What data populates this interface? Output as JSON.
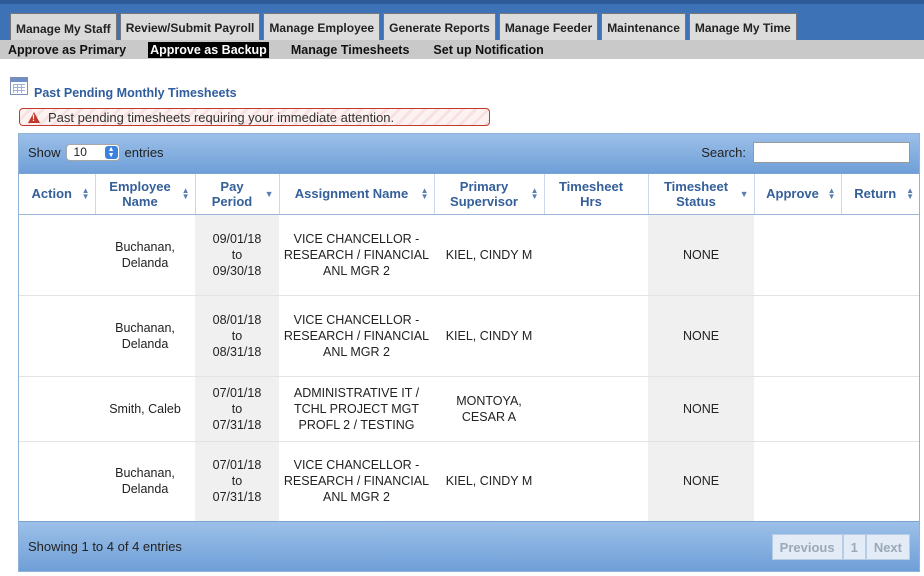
{
  "tabs": [
    {
      "label": "Manage My Staff"
    },
    {
      "label": "Review/Submit Payroll"
    },
    {
      "label": "Manage Employee"
    },
    {
      "label": "Generate Reports"
    },
    {
      "label": "Manage Feeder"
    },
    {
      "label": "Maintenance"
    },
    {
      "label": "Manage My Time"
    }
  ],
  "subnav": [
    {
      "label": "Approve as Primary"
    },
    {
      "label": "Approve as Backup"
    },
    {
      "label": "Manage Timesheets"
    },
    {
      "label": "Set up Notification"
    }
  ],
  "section": {
    "title": "Past Pending Monthly Timesheets"
  },
  "alert": {
    "message": "Past pending timesheets requiring your immediate attention."
  },
  "table_controls": {
    "show_label": "Show",
    "entries_value": "10",
    "entries_label": "entries",
    "search_label": "Search:",
    "search_value": ""
  },
  "columns": [
    {
      "label": "Action"
    },
    {
      "label": "Employee Name"
    },
    {
      "label": "Pay Period"
    },
    {
      "label": "Assignment Name"
    },
    {
      "label": "Primary Supervisor"
    },
    {
      "label": "Timesheet Hrs"
    },
    {
      "label": "Timesheet Status"
    },
    {
      "label": "Approve"
    },
    {
      "label": "Return"
    }
  ],
  "rows": [
    {
      "action": "",
      "employee": "Buchanan, Delanda",
      "period_start": "09/01/18",
      "period_to": "to",
      "period_end": "09/30/18",
      "assignment": "VICE CHANCELLOR - RESEARCH / FINANCIAL ANL MGR 2",
      "supervisor": "KIEL, CINDY M",
      "hrs": "",
      "status": "NONE",
      "approve": "",
      "return": ""
    },
    {
      "action": "",
      "employee": "Buchanan, Delanda",
      "period_start": "08/01/18",
      "period_to": "to",
      "period_end": "08/31/18",
      "assignment": "VICE CHANCELLOR - RESEARCH / FINANCIAL ANL MGR 2",
      "supervisor": "KIEL, CINDY M",
      "hrs": "",
      "status": "NONE",
      "approve": "",
      "return": ""
    },
    {
      "action": "",
      "employee": "Smith, Caleb",
      "period_start": "07/01/18",
      "period_to": "to",
      "period_end": "07/31/18",
      "assignment": "ADMINISTRATIVE IT / TCHL PROJECT MGT PROFL 2 / TESTING",
      "supervisor": "MONTOYA, CESAR A",
      "hrs": "",
      "status": "NONE",
      "approve": "",
      "return": ""
    },
    {
      "action": "",
      "employee": "Buchanan, Delanda",
      "period_start": "07/01/18",
      "period_to": "to",
      "period_end": "07/31/18",
      "assignment": "VICE CHANCELLOR - RESEARCH / FINANCIAL ANL MGR 2",
      "supervisor": "KIEL, CINDY M",
      "hrs": "",
      "status": "NONE",
      "approve": "",
      "return": ""
    }
  ],
  "footer": {
    "info": "Showing 1 to 4 of 4 entries",
    "previous": "Previous",
    "page": "1",
    "next": "Next"
  }
}
